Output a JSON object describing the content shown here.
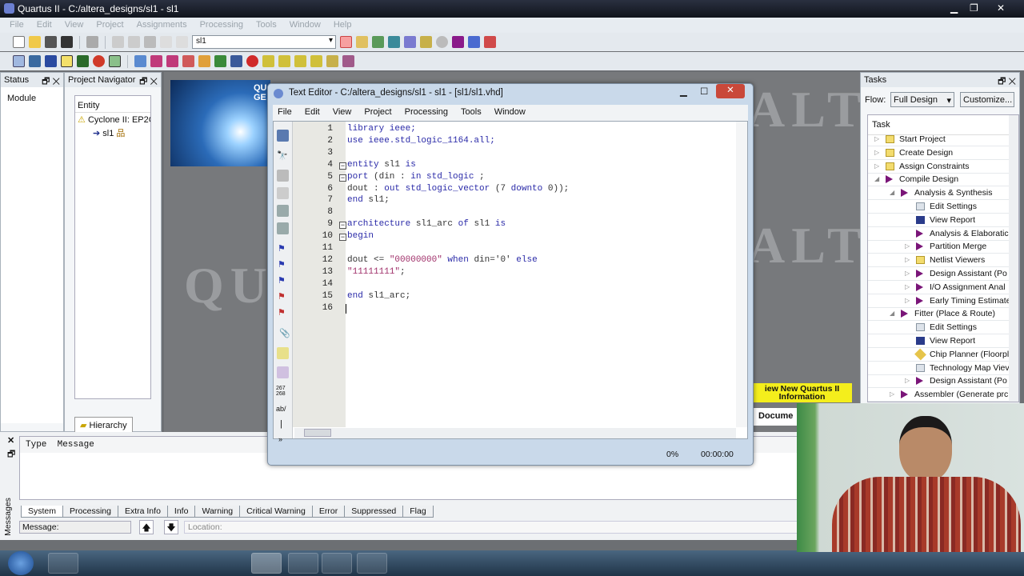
{
  "app": {
    "title": "Quartus II - C:/altera_designs/sl1 - sl1"
  },
  "menu": [
    "File",
    "Edit",
    "View",
    "Project",
    "Assignments",
    "Processing",
    "Tools",
    "Window",
    "Help"
  ],
  "toolbar": {
    "project_select": "sl1"
  },
  "status_panel": {
    "title": "Status",
    "column": "Module"
  },
  "navigator": {
    "title": "Project Navigator",
    "column": "Entity",
    "device": "Cyclone II: EP2C",
    "entity": "sl1",
    "tabs": [
      "Hierarchy"
    ]
  },
  "editor": {
    "title": "Text Editor - C:/altera_designs/sl1 - sl1 - [sl1/sl1.vhd]",
    "menu": [
      "File",
      "Edit",
      "View",
      "Project",
      "Processing",
      "Tools",
      "Window"
    ],
    "line_numbers": [
      "1",
      "2",
      "3",
      "4",
      "5",
      "6",
      "7",
      "8",
      "9",
      "10",
      "11",
      "12",
      "13",
      "14",
      "15",
      "16"
    ],
    "lines": [
      [
        [
          "kw",
          "library ieee;"
        ]
      ],
      [
        [
          "kw",
          "use ieee.std_logic_1164.all;"
        ]
      ],
      [],
      [
        [
          "kw",
          "entity"
        ],
        [
          "id",
          " sl1 "
        ],
        [
          "kw",
          "is"
        ]
      ],
      [
        [
          "kw",
          "port"
        ],
        [
          "id",
          " (din : "
        ],
        [
          "kw",
          "in std_logic"
        ],
        [
          "id",
          " ;"
        ]
      ],
      [
        [
          "id",
          "dout : "
        ],
        [
          "kw",
          "out std_logic_vector"
        ],
        [
          "id",
          " (7 "
        ],
        [
          "kw",
          "downto"
        ],
        [
          "id",
          " 0));"
        ]
      ],
      [
        [
          "kw",
          "end"
        ],
        [
          "id",
          " sl1;"
        ]
      ],
      [],
      [
        [
          "kw",
          "architecture"
        ],
        [
          "id",
          " sl1_arc "
        ],
        [
          "kw",
          "of"
        ],
        [
          "id",
          " sl1 "
        ],
        [
          "kw",
          "is"
        ]
      ],
      [
        [
          "kw",
          "begin"
        ]
      ],
      [],
      [
        [
          "id",
          "dout <= "
        ],
        [
          "st",
          "\"00000000\""
        ],
        [
          "kw",
          " when"
        ],
        [
          "id",
          " din='0' "
        ],
        [
          "kw",
          "else"
        ]
      ],
      [
        [
          "st",
          "\"11111111\""
        ],
        [
          "id",
          ";"
        ]
      ],
      [],
      [
        [
          "kw",
          "end"
        ],
        [
          "id",
          " sl1_arc;"
        ]
      ],
      []
    ],
    "progress": "0%",
    "elapsed": "00:00:00",
    "toolbar_counter": "267\n268"
  },
  "tasks": {
    "title": "Tasks",
    "flow_label": "Flow:",
    "flow_value": "Full Design",
    "customize": "Customize...",
    "column": "Task",
    "items": [
      {
        "label": "Start Project",
        "level": 0,
        "icon": "folder",
        "arrow": "▷"
      },
      {
        "label": "Create Design",
        "level": 0,
        "icon": "folder",
        "arrow": "▷"
      },
      {
        "label": "Assign Constraints",
        "level": 0,
        "icon": "folder",
        "arrow": "▷"
      },
      {
        "label": "Compile Design",
        "level": 0,
        "icon": "play",
        "arrow": "◢"
      },
      {
        "label": "Analysis & Synthesis",
        "level": 1,
        "icon": "play",
        "arrow": "◢"
      },
      {
        "label": "Edit Settings",
        "level": 2,
        "icon": "sett",
        "arrow": ""
      },
      {
        "label": "View Report",
        "level": 2,
        "icon": "rep",
        "arrow": ""
      },
      {
        "label": "Analysis & Elaboratic",
        "level": 2,
        "icon": "play",
        "arrow": ""
      },
      {
        "label": "Partition Merge",
        "level": 2,
        "icon": "play",
        "arrow": "▷"
      },
      {
        "label": "Netlist Viewers",
        "level": 2,
        "icon": "folder",
        "arrow": "▷"
      },
      {
        "label": "Design Assistant (Po",
        "level": 2,
        "icon": "play",
        "arrow": "▷"
      },
      {
        "label": "I/O Assignment Anal",
        "level": 2,
        "icon": "play",
        "arrow": "▷"
      },
      {
        "label": "Early Timing Estimate",
        "level": 2,
        "icon": "play",
        "arrow": "▷"
      },
      {
        "label": "Fitter (Place & Route)",
        "level": 1,
        "icon": "play",
        "arrow": "◢"
      },
      {
        "label": "Edit Settings",
        "level": 2,
        "icon": "sett",
        "arrow": ""
      },
      {
        "label": "View Report",
        "level": 2,
        "icon": "rep",
        "arrow": ""
      },
      {
        "label": "Chip Planner (Floorpl",
        "level": 2,
        "icon": "chip",
        "arrow": ""
      },
      {
        "label": "Technology Map Viev",
        "level": 2,
        "icon": "sett",
        "arrow": ""
      },
      {
        "label": "Design Assistant (Po",
        "level": 2,
        "icon": "play",
        "arrow": "▷"
      },
      {
        "label": "Assembler (Generate prc",
        "level": 1,
        "icon": "play",
        "arrow": "▷"
      }
    ]
  },
  "background": {
    "watermark_1": "ALTERA",
    "watermark_2": "QUARTUS",
    "splash_text": "QU GE",
    "tip": "iew New Quartus II Information",
    "doc_tab": "Docume"
  },
  "messages": {
    "side_label": "Messages",
    "column_header": "Type  Message",
    "tabs": [
      "System",
      "Processing",
      "Extra Info",
      "Info",
      "Warning",
      "Critical Warning",
      "Error",
      "Suppressed",
      "Flag"
    ],
    "message_label": "Message:",
    "location_label": "Location:"
  }
}
